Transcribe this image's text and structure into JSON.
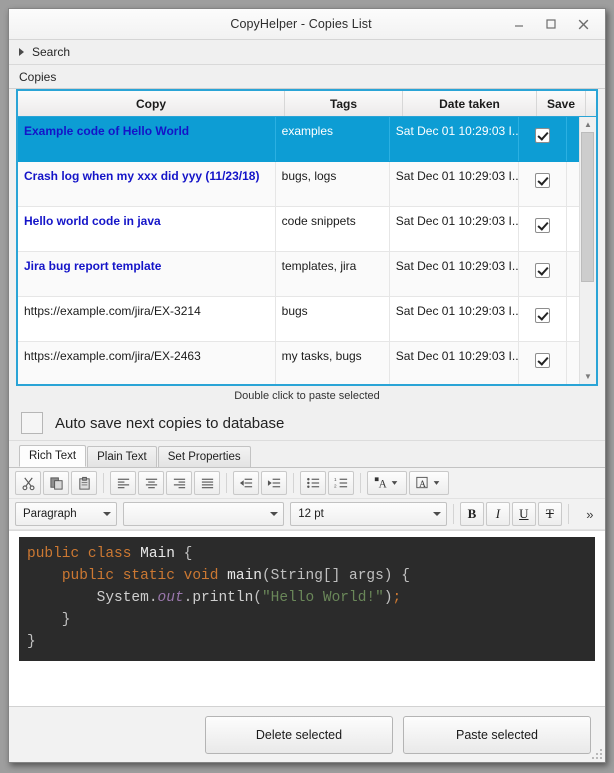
{
  "window": {
    "title": "CopyHelper - Copies List",
    "minimize_icon": "minimize-icon",
    "maximize_icon": "maximize-icon",
    "close_icon": "close-icon"
  },
  "search": {
    "label": "Search",
    "expander_icon": "triangle-right-icon"
  },
  "copies_group": {
    "label": "Copies"
  },
  "table": {
    "columns": [
      "Copy",
      "Tags",
      "Date taken",
      "Save"
    ],
    "rows": [
      {
        "copy": "Example code of Hello World",
        "tags": "examples",
        "date": "Sat Dec 01 10:29:03 I...",
        "save": true,
        "selected": true,
        "is_link": false
      },
      {
        "copy": "Crash log when my xxx did yyy (11/23/18)",
        "tags": "bugs, logs",
        "date": "Sat Dec 01 10:29:03 I...",
        "save": true,
        "selected": false,
        "is_link": false
      },
      {
        "copy": "Hello world code in java",
        "tags": "code snippets",
        "date": "Sat Dec 01 10:29:03 I...",
        "save": true,
        "selected": false,
        "is_link": false
      },
      {
        "copy": "Jira bug report template",
        "tags": "templates, jira",
        "date": "Sat Dec 01 10:29:03 I...",
        "save": true,
        "selected": false,
        "is_link": false
      },
      {
        "copy": "https://example.com/jira/EX-3214",
        "tags": "bugs",
        "date": "Sat Dec 01 10:29:03 I...",
        "save": true,
        "selected": false,
        "is_link": true
      },
      {
        "copy": "https://example.com/jira/EX-2463",
        "tags": "my tasks, bugs",
        "date": "Sat Dec 01 10:29:03 I...",
        "save": true,
        "selected": false,
        "is_link": true
      }
    ],
    "selection_color": "#0d9dd4",
    "border_color": "#2aa4d6",
    "link_text_color": "#1414c8"
  },
  "hint": {
    "text": "Double click to paste selected"
  },
  "autosave": {
    "label": "Auto save next copies to database",
    "checked": false
  },
  "tabs": [
    {
      "label": "Rich Text",
      "active": true
    },
    {
      "label": "Plain Text",
      "active": false
    },
    {
      "label": "Set Properties",
      "active": false
    }
  ],
  "format_toolbar": {
    "icons": [
      "cut-icon",
      "copy-icon",
      "paste-icon",
      "align-left-icon",
      "align-center-icon",
      "align-right-icon",
      "align-justify-icon",
      "decrease-indent-icon",
      "increase-indent-icon",
      "bullet-list-icon",
      "numbered-list-icon",
      "text-color-icon",
      "background-color-icon"
    ]
  },
  "font_toolbar": {
    "style_value": "Paragraph",
    "font_value": "",
    "size_value": "12 pt",
    "bold_label": "B",
    "italic_label": "I",
    "underline_label": "U",
    "strikethrough_label": "T",
    "overflow_label": "»"
  },
  "editor": {
    "code_lines": [
      [
        {
          "t": "public",
          "c": "kw"
        },
        {
          "t": " ",
          "c": "pn"
        },
        {
          "t": "class",
          "c": "kw"
        },
        {
          "t": " ",
          "c": "pn"
        },
        {
          "t": "Main",
          "c": "fn"
        },
        {
          "t": " {",
          "c": "pn"
        }
      ],
      [
        {
          "t": "    ",
          "c": "pn"
        },
        {
          "t": "public",
          "c": "kw"
        },
        {
          "t": " ",
          "c": "pn"
        },
        {
          "t": "static",
          "c": "kw"
        },
        {
          "t": " ",
          "c": "pn"
        },
        {
          "t": "void",
          "c": "kw"
        },
        {
          "t": " ",
          "c": "pn"
        },
        {
          "t": "main",
          "c": "fn"
        },
        {
          "t": "(String[] args) {",
          "c": "pn"
        }
      ],
      [
        {
          "t": "        ",
          "c": "pn"
        },
        {
          "t": "System",
          "c": "id"
        },
        {
          "t": ".",
          "c": "pn"
        },
        {
          "t": "out",
          "c": "fld"
        },
        {
          "t": ".",
          "c": "pn"
        },
        {
          "t": "println",
          "c": "id"
        },
        {
          "t": "(",
          "c": "pn"
        },
        {
          "t": "\"Hello World!\"",
          "c": "str"
        },
        {
          "t": ")",
          "c": "pn"
        },
        {
          "t": ";",
          "c": "semi"
        }
      ],
      [
        {
          "t": "    }",
          "c": "pn"
        }
      ],
      [
        {
          "t": "}",
          "c": "pn"
        }
      ]
    ],
    "background": "#2b2b2b"
  },
  "buttons": {
    "delete_selected": "Delete selected",
    "paste_selected": "Paste selected"
  }
}
